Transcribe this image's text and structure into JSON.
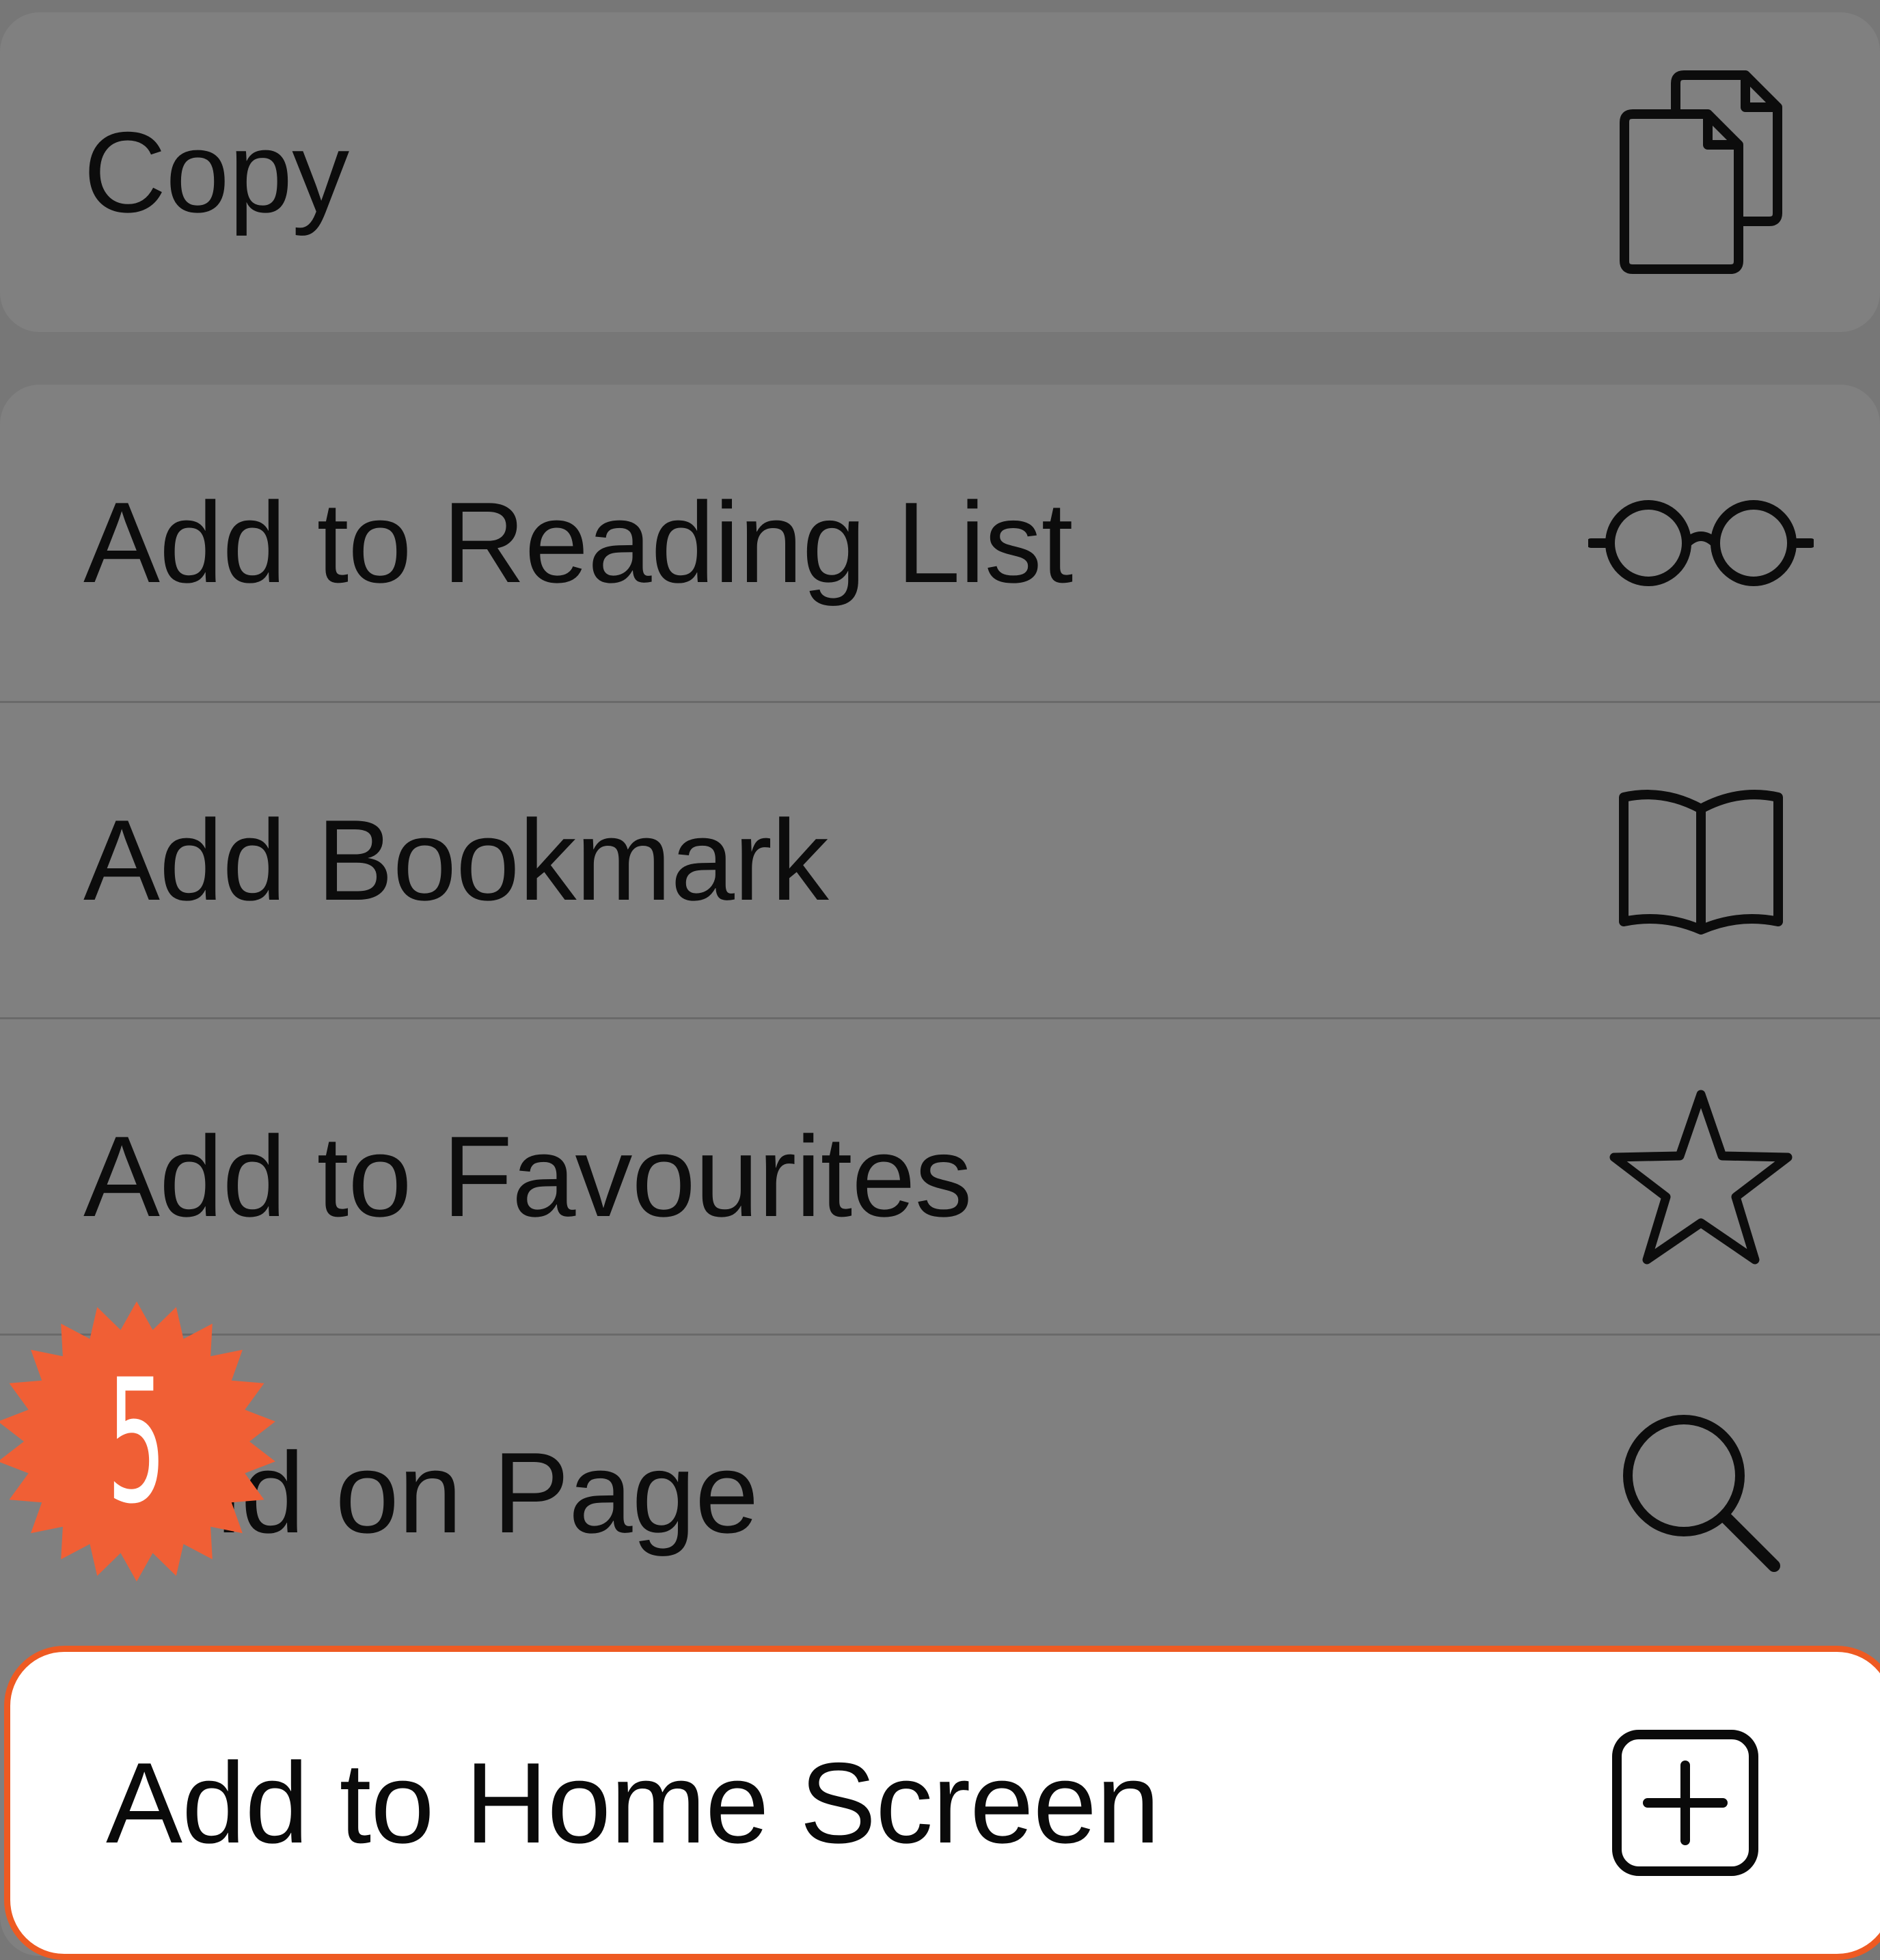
{
  "menu": {
    "copy": {
      "label": "Copy",
      "icon": "copy-icon"
    },
    "items": [
      {
        "label": "Add to Reading List",
        "icon": "glasses-icon"
      },
      {
        "label": "Add Bookmark",
        "icon": "book-icon"
      },
      {
        "label": "Add to Favourites",
        "icon": "star-icon"
      },
      {
        "label": "Find on Page",
        "icon": "magnifier-icon"
      }
    ],
    "highlighted": {
      "label": "Add to Home Screen",
      "icon": "plus-square-icon"
    }
  },
  "step_badge": {
    "number": "5",
    "color": "#f05f35"
  },
  "colors": {
    "highlight_border": "#ee5a22",
    "menu_background": "#808080",
    "text": "#0c0c0c"
  }
}
